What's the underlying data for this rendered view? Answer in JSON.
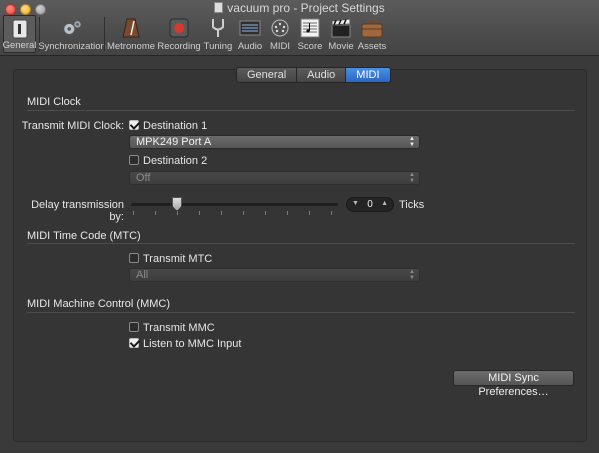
{
  "window": {
    "title": "vacuum pro - Project Settings"
  },
  "toolbar": {
    "items": [
      {
        "label": "General",
        "icon": "general-icon"
      },
      {
        "label": "Synchronization",
        "icon": "gears-icon"
      },
      {
        "label": "Metronome",
        "icon": "metronome-icon"
      },
      {
        "label": "Recording",
        "icon": "record-icon"
      },
      {
        "label": "Tuning",
        "icon": "tuning-fork-icon"
      },
      {
        "label": "Audio",
        "icon": "audio-icon"
      },
      {
        "label": "MIDI",
        "icon": "midi-port-icon"
      },
      {
        "label": "Score",
        "icon": "score-icon"
      },
      {
        "label": "Movie",
        "icon": "clapperboard-icon"
      },
      {
        "label": "Assets",
        "icon": "briefcase-icon"
      }
    ],
    "active": "General"
  },
  "tabs": {
    "general": "General",
    "audio": "Audio",
    "midi": "MIDI",
    "selected": "MIDI"
  },
  "midi_clock": {
    "heading": "MIDI Clock",
    "transmit_label": "Transmit MIDI Clock:",
    "destination1": {
      "label": "Destination 1",
      "checked": true,
      "port": "MPK249 Port A"
    },
    "destination2": {
      "label": "Destination 2",
      "checked": false,
      "port": "Off"
    },
    "delay": {
      "label": "Delay transmission by:",
      "value": "0",
      "unit": "Ticks"
    }
  },
  "mtc": {
    "heading": "MIDI Time Code (MTC)",
    "transmit": {
      "label": "Transmit MTC",
      "checked": false
    },
    "port": "All"
  },
  "mmc": {
    "heading": "MIDI Machine Control (MMC)",
    "transmit": {
      "label": "Transmit MMC",
      "checked": false
    },
    "listen": {
      "label": "Listen to MMC Input",
      "checked": true
    }
  },
  "buttons": {
    "sync_prefs": "MIDI Sync Preferences…"
  },
  "colors": {
    "accent": "#2b67c4",
    "record": "#d63a2f"
  }
}
